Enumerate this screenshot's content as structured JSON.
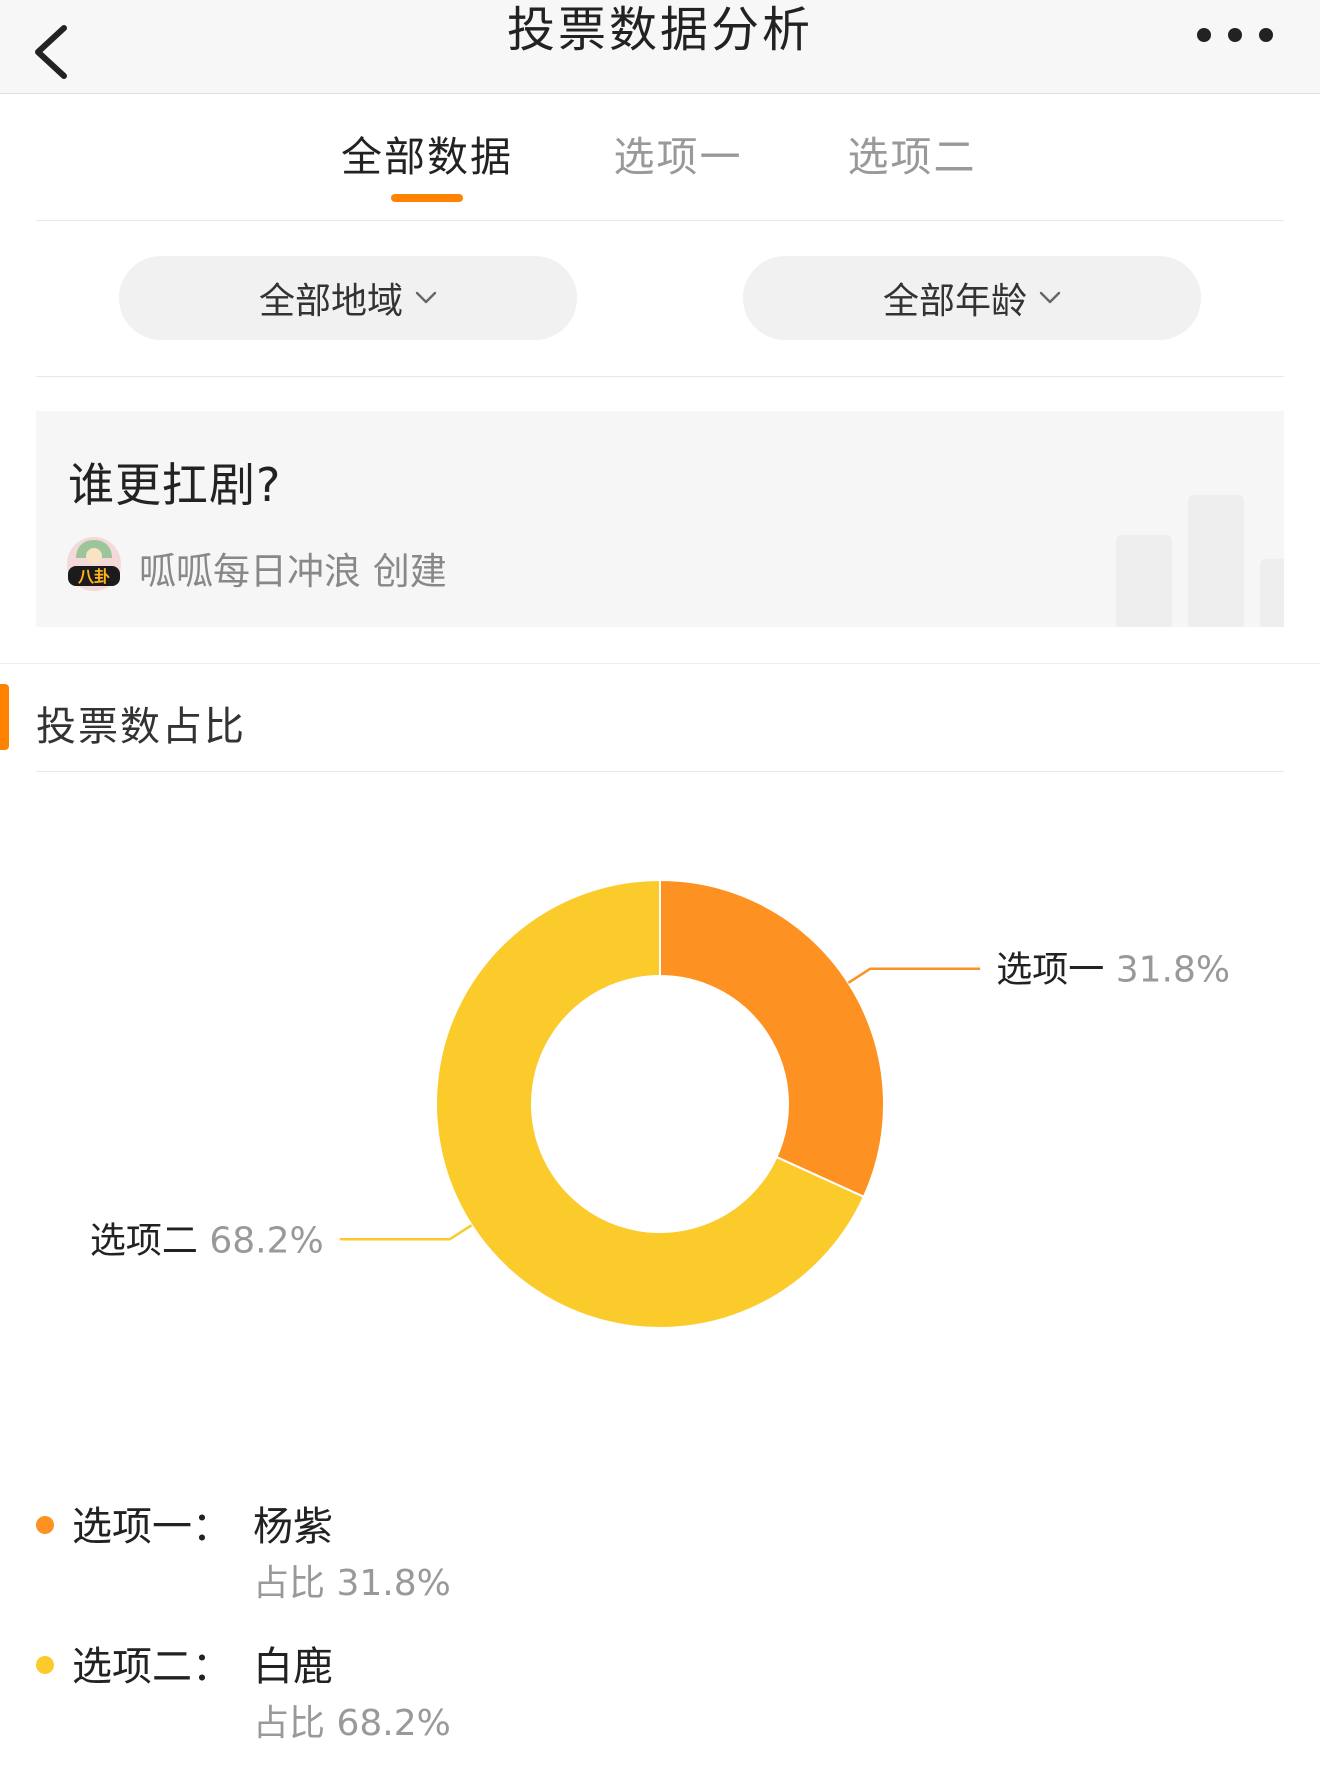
{
  "nav": {
    "title": "投票数据分析",
    "back_icon": "chevron-left-icon",
    "more_icon": "ellipsis-icon"
  },
  "tabs": [
    {
      "label": "全部数据",
      "active": true
    },
    {
      "label": "选项一",
      "active": false
    },
    {
      "label": "选项二",
      "active": false
    }
  ],
  "accent_color": "#ff8200",
  "filters": {
    "region": {
      "label": "全部地域",
      "icon": "chevron-down-icon"
    },
    "age": {
      "label": "全部年龄",
      "icon": "chevron-down-icon"
    }
  },
  "poll": {
    "question": "谁更扛剧?",
    "creator_line": "呱呱每日冲浪 创建",
    "avatar_text": "八卦"
  },
  "section": {
    "title": "投票数占比"
  },
  "chart_data": {
    "type": "pie",
    "variant": "donut",
    "categories": [
      "选项一",
      "选项二"
    ],
    "values": [
      31.8,
      68.2
    ],
    "value_labels": [
      "31.8%",
      "68.2%"
    ],
    "colors": [
      "#fd9223",
      "#fbcb2b"
    ],
    "legend": [
      {
        "prefix": "选项一：",
        "name": "杨紫",
        "share": "占比 31.8%",
        "color": "#fd9223"
      },
      {
        "prefix": "选项二：",
        "name": "白鹿",
        "share": "占比 68.2%",
        "color": "#fbcb2b"
      }
    ]
  }
}
